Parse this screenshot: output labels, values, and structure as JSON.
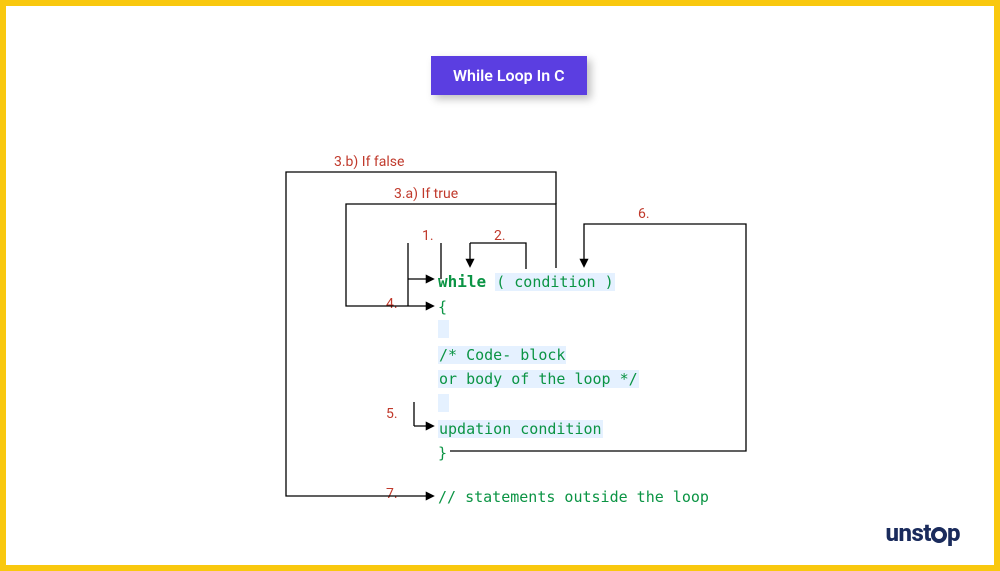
{
  "title": "While Loop In C",
  "labels": {
    "n1": "1.",
    "n2": "2.",
    "n3a": "3.a) If true",
    "n3b": "3.b) If false",
    "n4": "4.",
    "n5": "5.",
    "n6": "6.",
    "n7": "7."
  },
  "code": {
    "while_kw": "while",
    "while_cond": "( condition )",
    "brace_open": "{",
    "body1": "/* Code- block",
    "body2": "or body of the loop */",
    "updation": "updation condition",
    "brace_close": "}",
    "outside": "// statements outside the loop"
  },
  "logo": {
    "pre": "unst",
    "post": "p"
  },
  "colors": {
    "border": "#f9c80e",
    "badge": "#5b3ee1",
    "label": "#c0392b",
    "code": "#0b9444",
    "logo": "#1a2b5c"
  }
}
